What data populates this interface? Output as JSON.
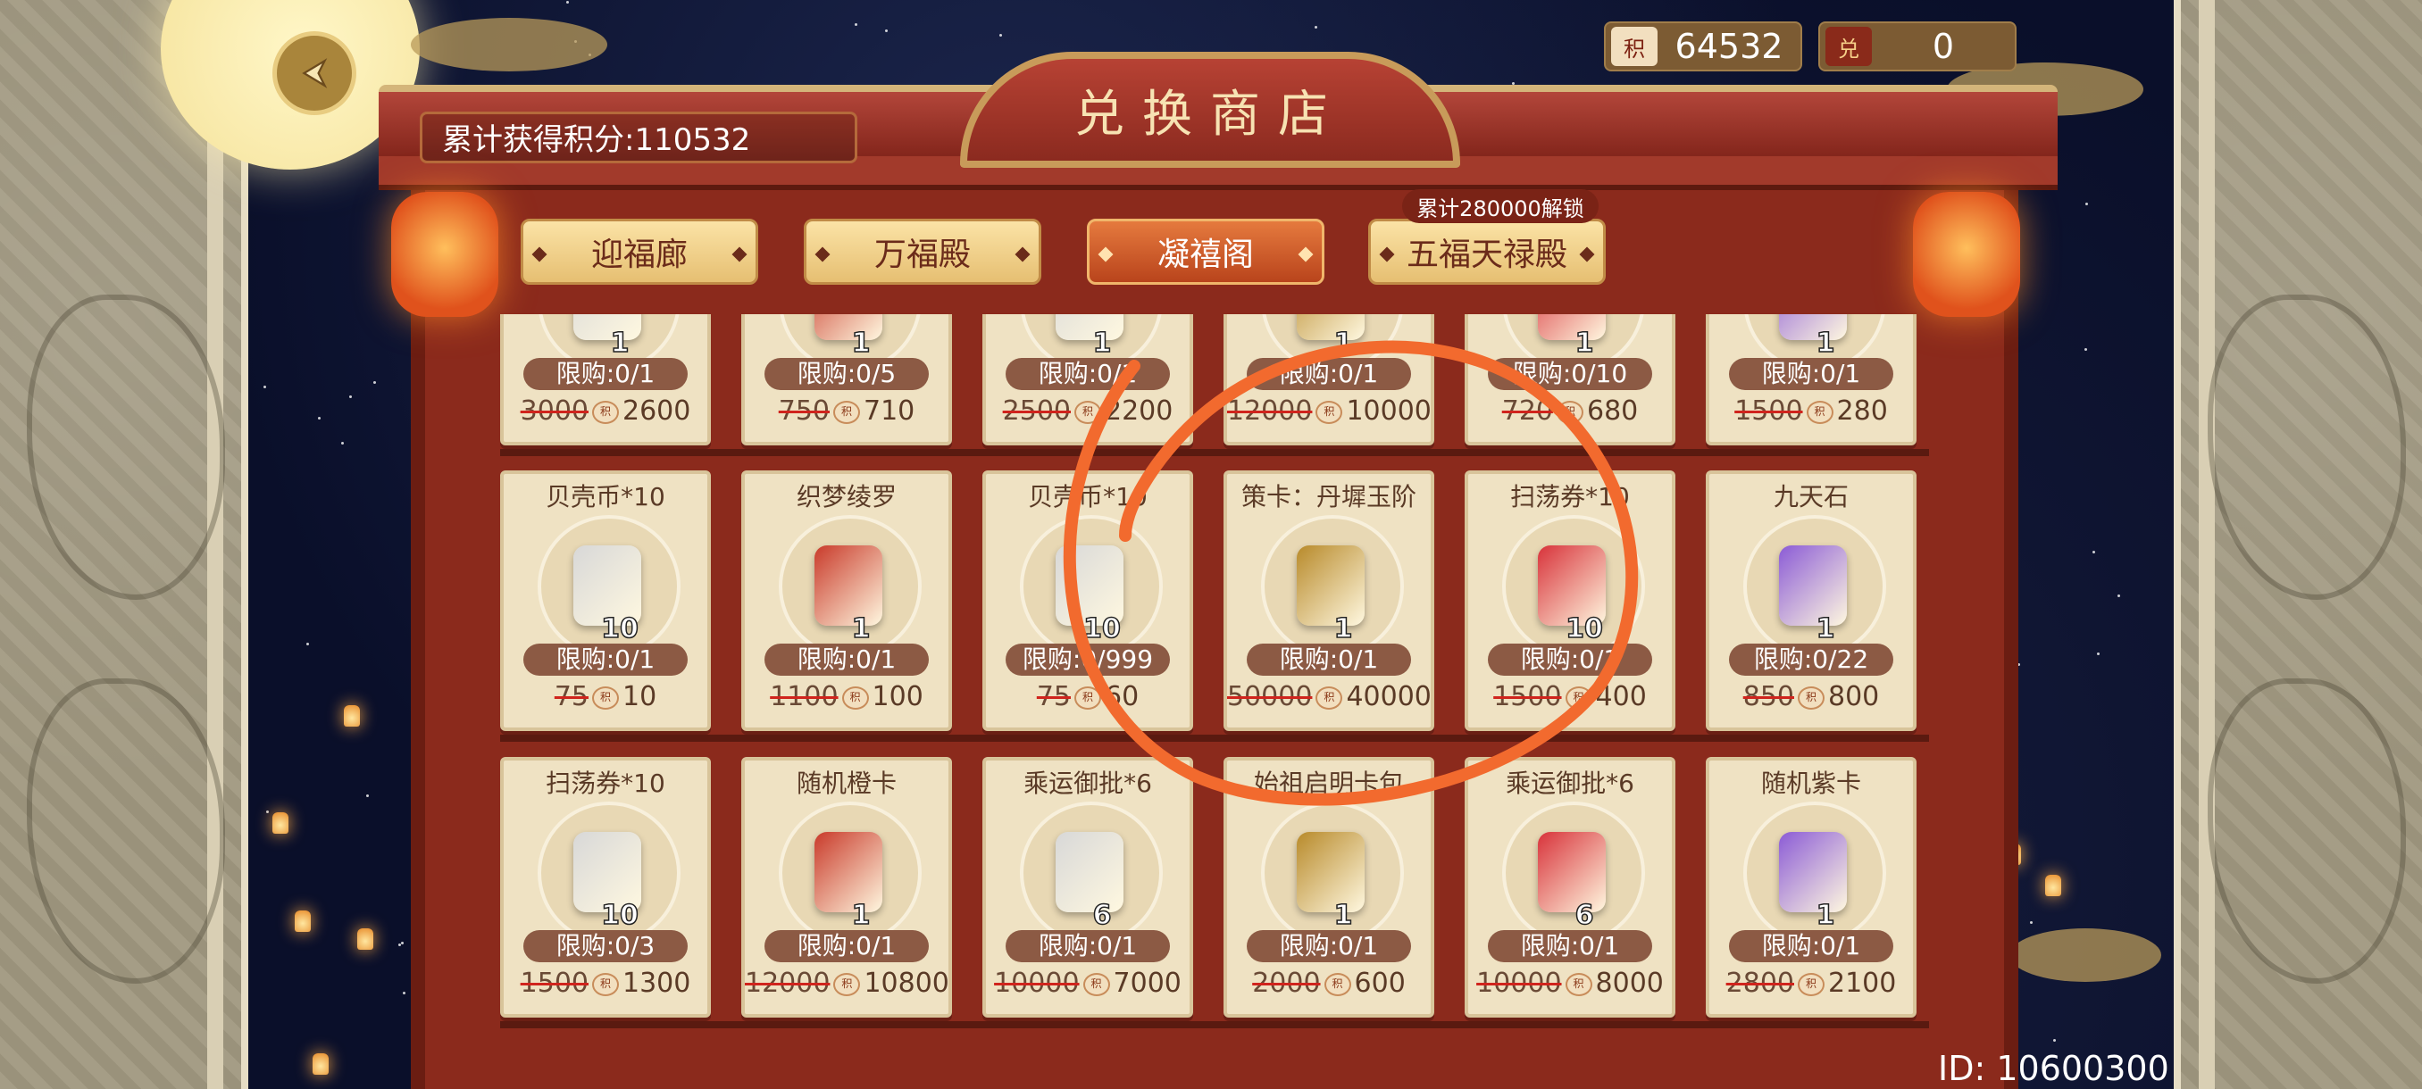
{
  "header": {
    "back_icon": "back-arrow-icon",
    "total_points_label": "累计获得积分:110532",
    "shop_title": "兑换商店"
  },
  "currency": [
    {
      "icon": "points-fan-icon",
      "icon_text": "积",
      "value": "64532"
    },
    {
      "icon": "exchange-ticket-icon",
      "icon_text": "兑",
      "value": "0"
    }
  ],
  "tabs": [
    {
      "label": "迎福廊",
      "active": false
    },
    {
      "label": "万福殿",
      "active": false
    },
    {
      "label": "凝禧阁",
      "active": true
    },
    {
      "label": "五福天禄殿",
      "active": false
    }
  ],
  "unlock_badge": "累计280000解锁",
  "point_icon_text": "积",
  "rows": [
    [
      {
        "name": "",
        "qty": "1",
        "limit": "限购:0/1",
        "old_price": "3000",
        "price": "2600"
      },
      {
        "name": "",
        "qty": "1",
        "limit": "限购:0/5",
        "old_price": "750",
        "price": "710"
      },
      {
        "name": "",
        "qty": "1",
        "limit": "限购:0/1",
        "old_price": "2500",
        "price": "2200"
      },
      {
        "name": "",
        "qty": "1",
        "limit": "限购:0/1",
        "old_price": "12000",
        "price": "10000"
      },
      {
        "name": "",
        "qty": "1",
        "limit": "限购:0/10",
        "old_price": "720",
        "price": "680"
      },
      {
        "name": "",
        "qty": "1",
        "limit": "限购:0/1",
        "old_price": "1500",
        "price": "280"
      }
    ],
    [
      {
        "name": "贝壳币*10",
        "qty": "10",
        "limit": "限购:0/1",
        "old_price": "75",
        "price": "10"
      },
      {
        "name": "织梦绫罗",
        "qty": "1",
        "limit": "限购:0/1",
        "old_price": "1100",
        "price": "100"
      },
      {
        "name": "贝壳币*10",
        "qty": "10",
        "limit": "限购:0/999",
        "old_price": "75",
        "price": "60"
      },
      {
        "name": "策卡：丹墀玉阶",
        "qty": "1",
        "limit": "限购:0/1",
        "old_price": "50000",
        "price": "40000"
      },
      {
        "name": "扫荡券*10",
        "qty": "10",
        "limit": "限购:0/1",
        "old_price": "1500",
        "price": "400"
      },
      {
        "name": "九天石",
        "qty": "1",
        "limit": "限购:0/22",
        "old_price": "850",
        "price": "800"
      }
    ],
    [
      {
        "name": "扫荡券*10",
        "qty": "10",
        "limit": "限购:0/3",
        "old_price": "1500",
        "price": "1300"
      },
      {
        "name": "随机橙卡",
        "qty": "1",
        "limit": "限购:0/1",
        "old_price": "12000",
        "price": "10800"
      },
      {
        "name": "乘运御批*6",
        "qty": "6",
        "limit": "限购:0/1",
        "old_price": "10000",
        "price": "7000"
      },
      {
        "name": "始祖启明卡包",
        "qty": "1",
        "limit": "限购:0/1",
        "old_price": "2000",
        "price": "600"
      },
      {
        "name": "乘运御批*6",
        "qty": "6",
        "limit": "限购:0/1",
        "old_price": "10000",
        "price": "8000"
      },
      {
        "name": "随机紫卡",
        "qty": "1",
        "limit": "限购:0/1",
        "old_price": "2800",
        "price": "2100"
      }
    ]
  ],
  "player_id": "ID: 10600300",
  "colors": {
    "board_red": "#8b2a1c",
    "tab_active": "#d0602a",
    "annotation_orange": "#f26a2e"
  }
}
